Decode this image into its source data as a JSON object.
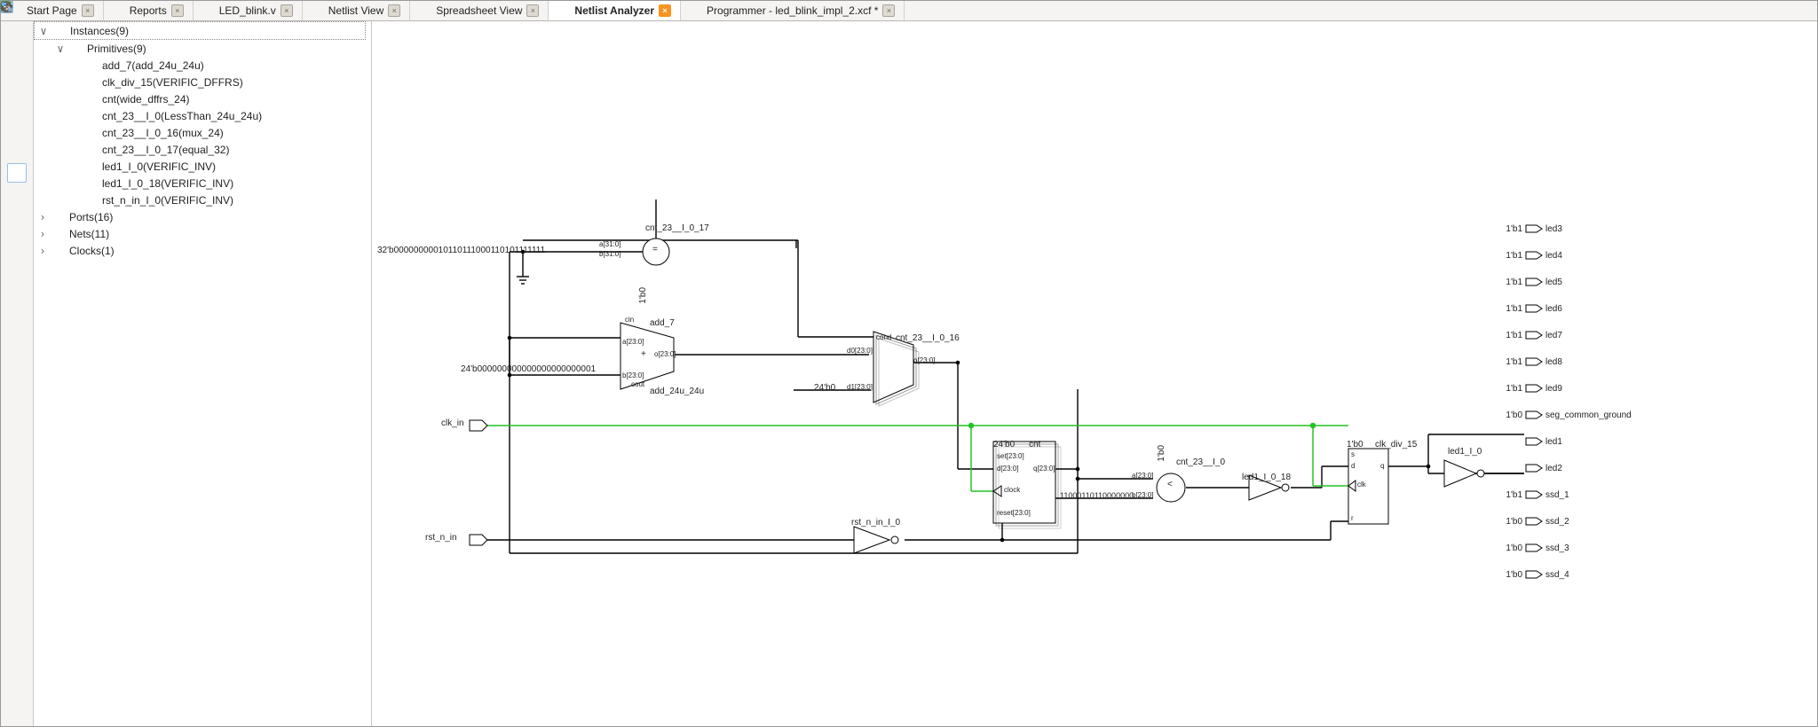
{
  "tabs": [
    {
      "label": "Start Page",
      "icon": "page",
      "active": false
    },
    {
      "label": "Reports",
      "icon": "reports",
      "active": false
    },
    {
      "label": "LED_blink.v",
      "icon": "verilog",
      "active": false
    },
    {
      "label": "Netlist View",
      "icon": "netlist",
      "active": false
    },
    {
      "label": "Spreadsheet View",
      "icon": "sheet",
      "active": false
    },
    {
      "label": "Netlist Analyzer",
      "icon": "analyzer",
      "active": true
    },
    {
      "label": "Programmer - led_blink_impl_2.xcf *",
      "icon": "prog",
      "active": false
    }
  ],
  "tree": {
    "root": {
      "label": "Instances(9)"
    },
    "primitives": {
      "label": "Primitives(9)"
    },
    "items": [
      "add_7(add_24u_24u)",
      "clk_div_15(VERIFIC_DFFRS)",
      "cnt(wide_dffrs_24)",
      "cnt_23__I_0(LessThan_24u_24u)",
      "cnt_23__I_0_16(mux_24)",
      "cnt_23__I_0_17(equal_32)",
      "led1_I_0(VERIFIC_INV)",
      "led1_I_0_18(VERIFIC_INV)",
      "rst_n_in_I_0(VERIFIC_INV)"
    ],
    "ports": "Ports(16)",
    "nets": "Nets(11)",
    "clocks": "Clocks(1)"
  },
  "schem": {
    "const32": "32'b00000000010110111000110101111111",
    "a31": "a[31:0]",
    "b31": "b[31:0]",
    "eq": "cnt_23__I_0_17",
    "eq_op": "=",
    "onebit0": "1'b0",
    "add7": "add_7",
    "cin": "cin",
    "a23": "a[23:0]",
    "b23": "b[23:0]",
    "o23": "o[23:0]",
    "plus": "+",
    "cout": "cout",
    "addtype": "add_24u_24u",
    "const24": "24'b000000000000000000000001",
    "d0": "d0[23:0]",
    "d1": "d1[23:0]",
    "z24": "24'b0",
    "cond": "cond",
    "mux": "cnt_23__I_0_16",
    "clk_in": "clk_in",
    "rst_n_in": "rst_n_in",
    "rstinv": "rst_n_in_I_0",
    "cnt": "cnt",
    "cnt_pre": "24'b0",
    "set": "set[23:0]",
    "d": "d[23:0]",
    "q": "q[23:0]",
    "clock": "clock",
    "reset": "reset[23:0]",
    "lt": "cnt_23__I_0",
    "ltconst": "11000110110000000",
    "lt_op": "<",
    "inv18": "led1_I_0_18",
    "clkdiv": "clk_div_15",
    "clkdiv_pre": "1'b0",
    "s": "s",
    "d1b": "d",
    "q1": "q",
    "clk": "clk",
    "r": "r",
    "led1inv": "led1_I_0",
    "outputs": [
      {
        "c": "1'b1",
        "n": "led3"
      },
      {
        "c": "1'b1",
        "n": "led4"
      },
      {
        "c": "1'b1",
        "n": "led5"
      },
      {
        "c": "1'b1",
        "n": "led6"
      },
      {
        "c": "1'b1",
        "n": "led7"
      },
      {
        "c": "1'b1",
        "n": "led8"
      },
      {
        "c": "1'b1",
        "n": "led9"
      },
      {
        "c": "1'b0",
        "n": "seg_common_ground"
      },
      {
        "c": "",
        "n": "led1"
      },
      {
        "c": "",
        "n": "led2"
      },
      {
        "c": "1'b1",
        "n": "ssd_1"
      },
      {
        "c": "1'b0",
        "n": "ssd_2"
      },
      {
        "c": "1'b0",
        "n": "ssd_3"
      },
      {
        "c": "1'b0",
        "n": "ssd_4"
      }
    ]
  }
}
